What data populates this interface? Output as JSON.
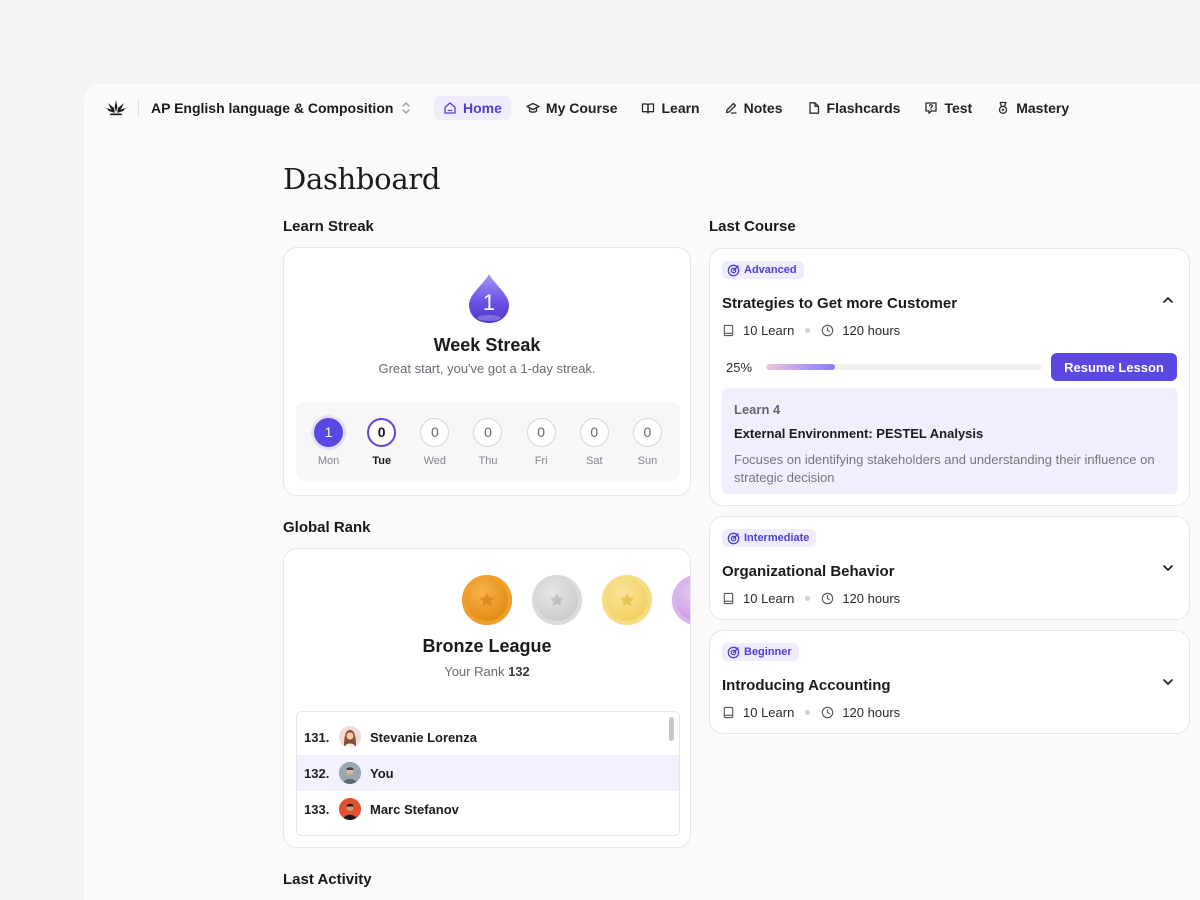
{
  "header": {
    "course_name": "AP English language & Composition",
    "nav": [
      {
        "label": "Home",
        "icon": "home-icon",
        "active": true
      },
      {
        "label": "My Course",
        "icon": "graduation-cap-icon"
      },
      {
        "label": "Learn",
        "icon": "book-open-icon"
      },
      {
        "label": "Notes",
        "icon": "pencil-icon"
      },
      {
        "label": "Flashcards",
        "icon": "file-icon"
      },
      {
        "label": "Test",
        "icon": "question-icon"
      },
      {
        "label": "Mastery",
        "icon": "medal-icon"
      }
    ]
  },
  "page": {
    "title": "Dashboard"
  },
  "streak": {
    "section_label": "Learn Streak",
    "count": "1",
    "title": "Week Streak",
    "subtitle": "Great start, you've got a 1-day streak.",
    "days": [
      {
        "name": "Mon",
        "value": "1",
        "state": "done"
      },
      {
        "name": "Tue",
        "value": "0",
        "state": "today"
      },
      {
        "name": "Wed",
        "value": "0",
        "state": "none"
      },
      {
        "name": "Thu",
        "value": "0",
        "state": "none"
      },
      {
        "name": "Fri",
        "value": "0",
        "state": "none"
      },
      {
        "name": "Sat",
        "value": "0",
        "state": "none"
      },
      {
        "name": "Sun",
        "value": "0",
        "state": "none"
      }
    ]
  },
  "rank": {
    "section_label": "Global Rank",
    "league": "Bronze League",
    "rank_prefix": "Your Rank",
    "rank_value": "132",
    "leaderboard": [
      {
        "rank": "131.",
        "name": "Stevanie Lorenza"
      },
      {
        "rank": "132.",
        "name": "You",
        "me": true
      },
      {
        "rank": "133.",
        "name": "Marc Stefanov"
      }
    ]
  },
  "activity": {
    "section_label": "Last Activity"
  },
  "last_course": {
    "section_label": "Last Course",
    "courses": [
      {
        "level": "Advanced",
        "title": "Strategies to Get more Customer",
        "learn_count": "10 Learn",
        "hours": "120 hours",
        "expanded": true,
        "progress_label": "25%",
        "progress": 0.25,
        "resume_label": "Resume Lesson",
        "lesson": {
          "number": "Learn 4",
          "title": "External Environment: PESTEL Analysis",
          "description": "Focuses on identifying stakeholders and understanding their influence on strategic decision"
        }
      },
      {
        "level": "Intermediate",
        "title": "Organizational Behavior",
        "learn_count": "10 Learn",
        "hours": "120 hours",
        "expanded": false
      },
      {
        "level": "Beginner",
        "title": "Introducing Accounting",
        "learn_count": "10 Learn",
        "hours": "120 hours",
        "expanded": false
      }
    ]
  },
  "colors": {
    "accent": "#5a48e3",
    "accent_soft": "#efedfd",
    "bronze": "#e8951d"
  }
}
